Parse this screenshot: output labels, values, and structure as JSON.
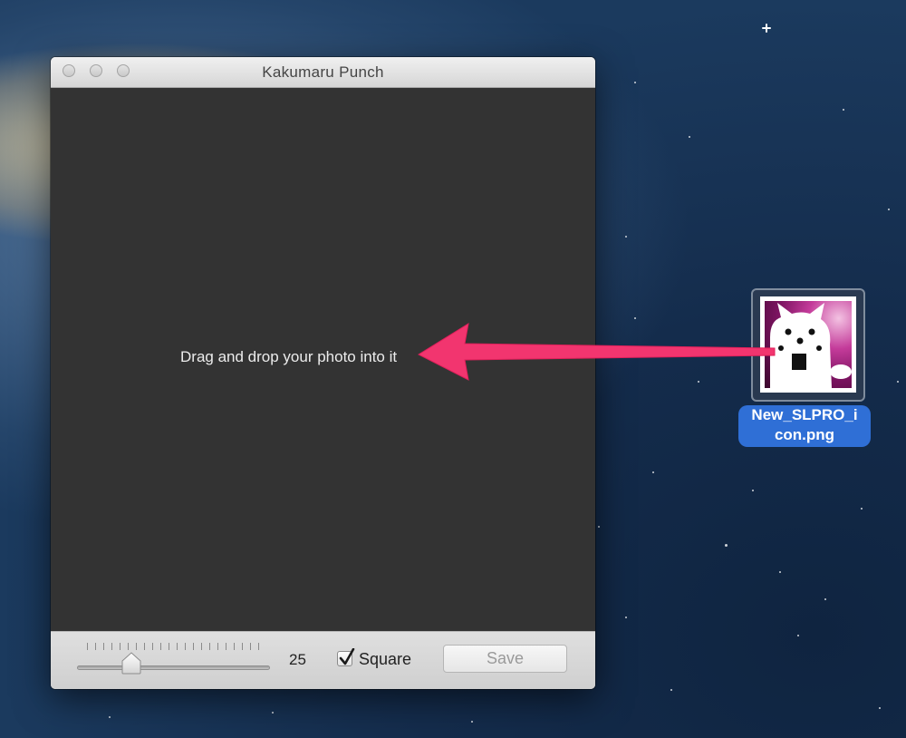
{
  "window": {
    "title": "Kakumaru Punch",
    "drop_hint": "Drag and drop your photo into it"
  },
  "controls": {
    "slider_value": "25",
    "square_label": "Square",
    "square_checked": true,
    "save_label": "Save"
  },
  "desktop_file": {
    "name_line1": "New_SLPRO_i",
    "name_line2": "con.png"
  },
  "colors": {
    "annotation_arrow": "#f2356f",
    "selection_label": "#2f6fd6",
    "canvas": "#333333"
  }
}
